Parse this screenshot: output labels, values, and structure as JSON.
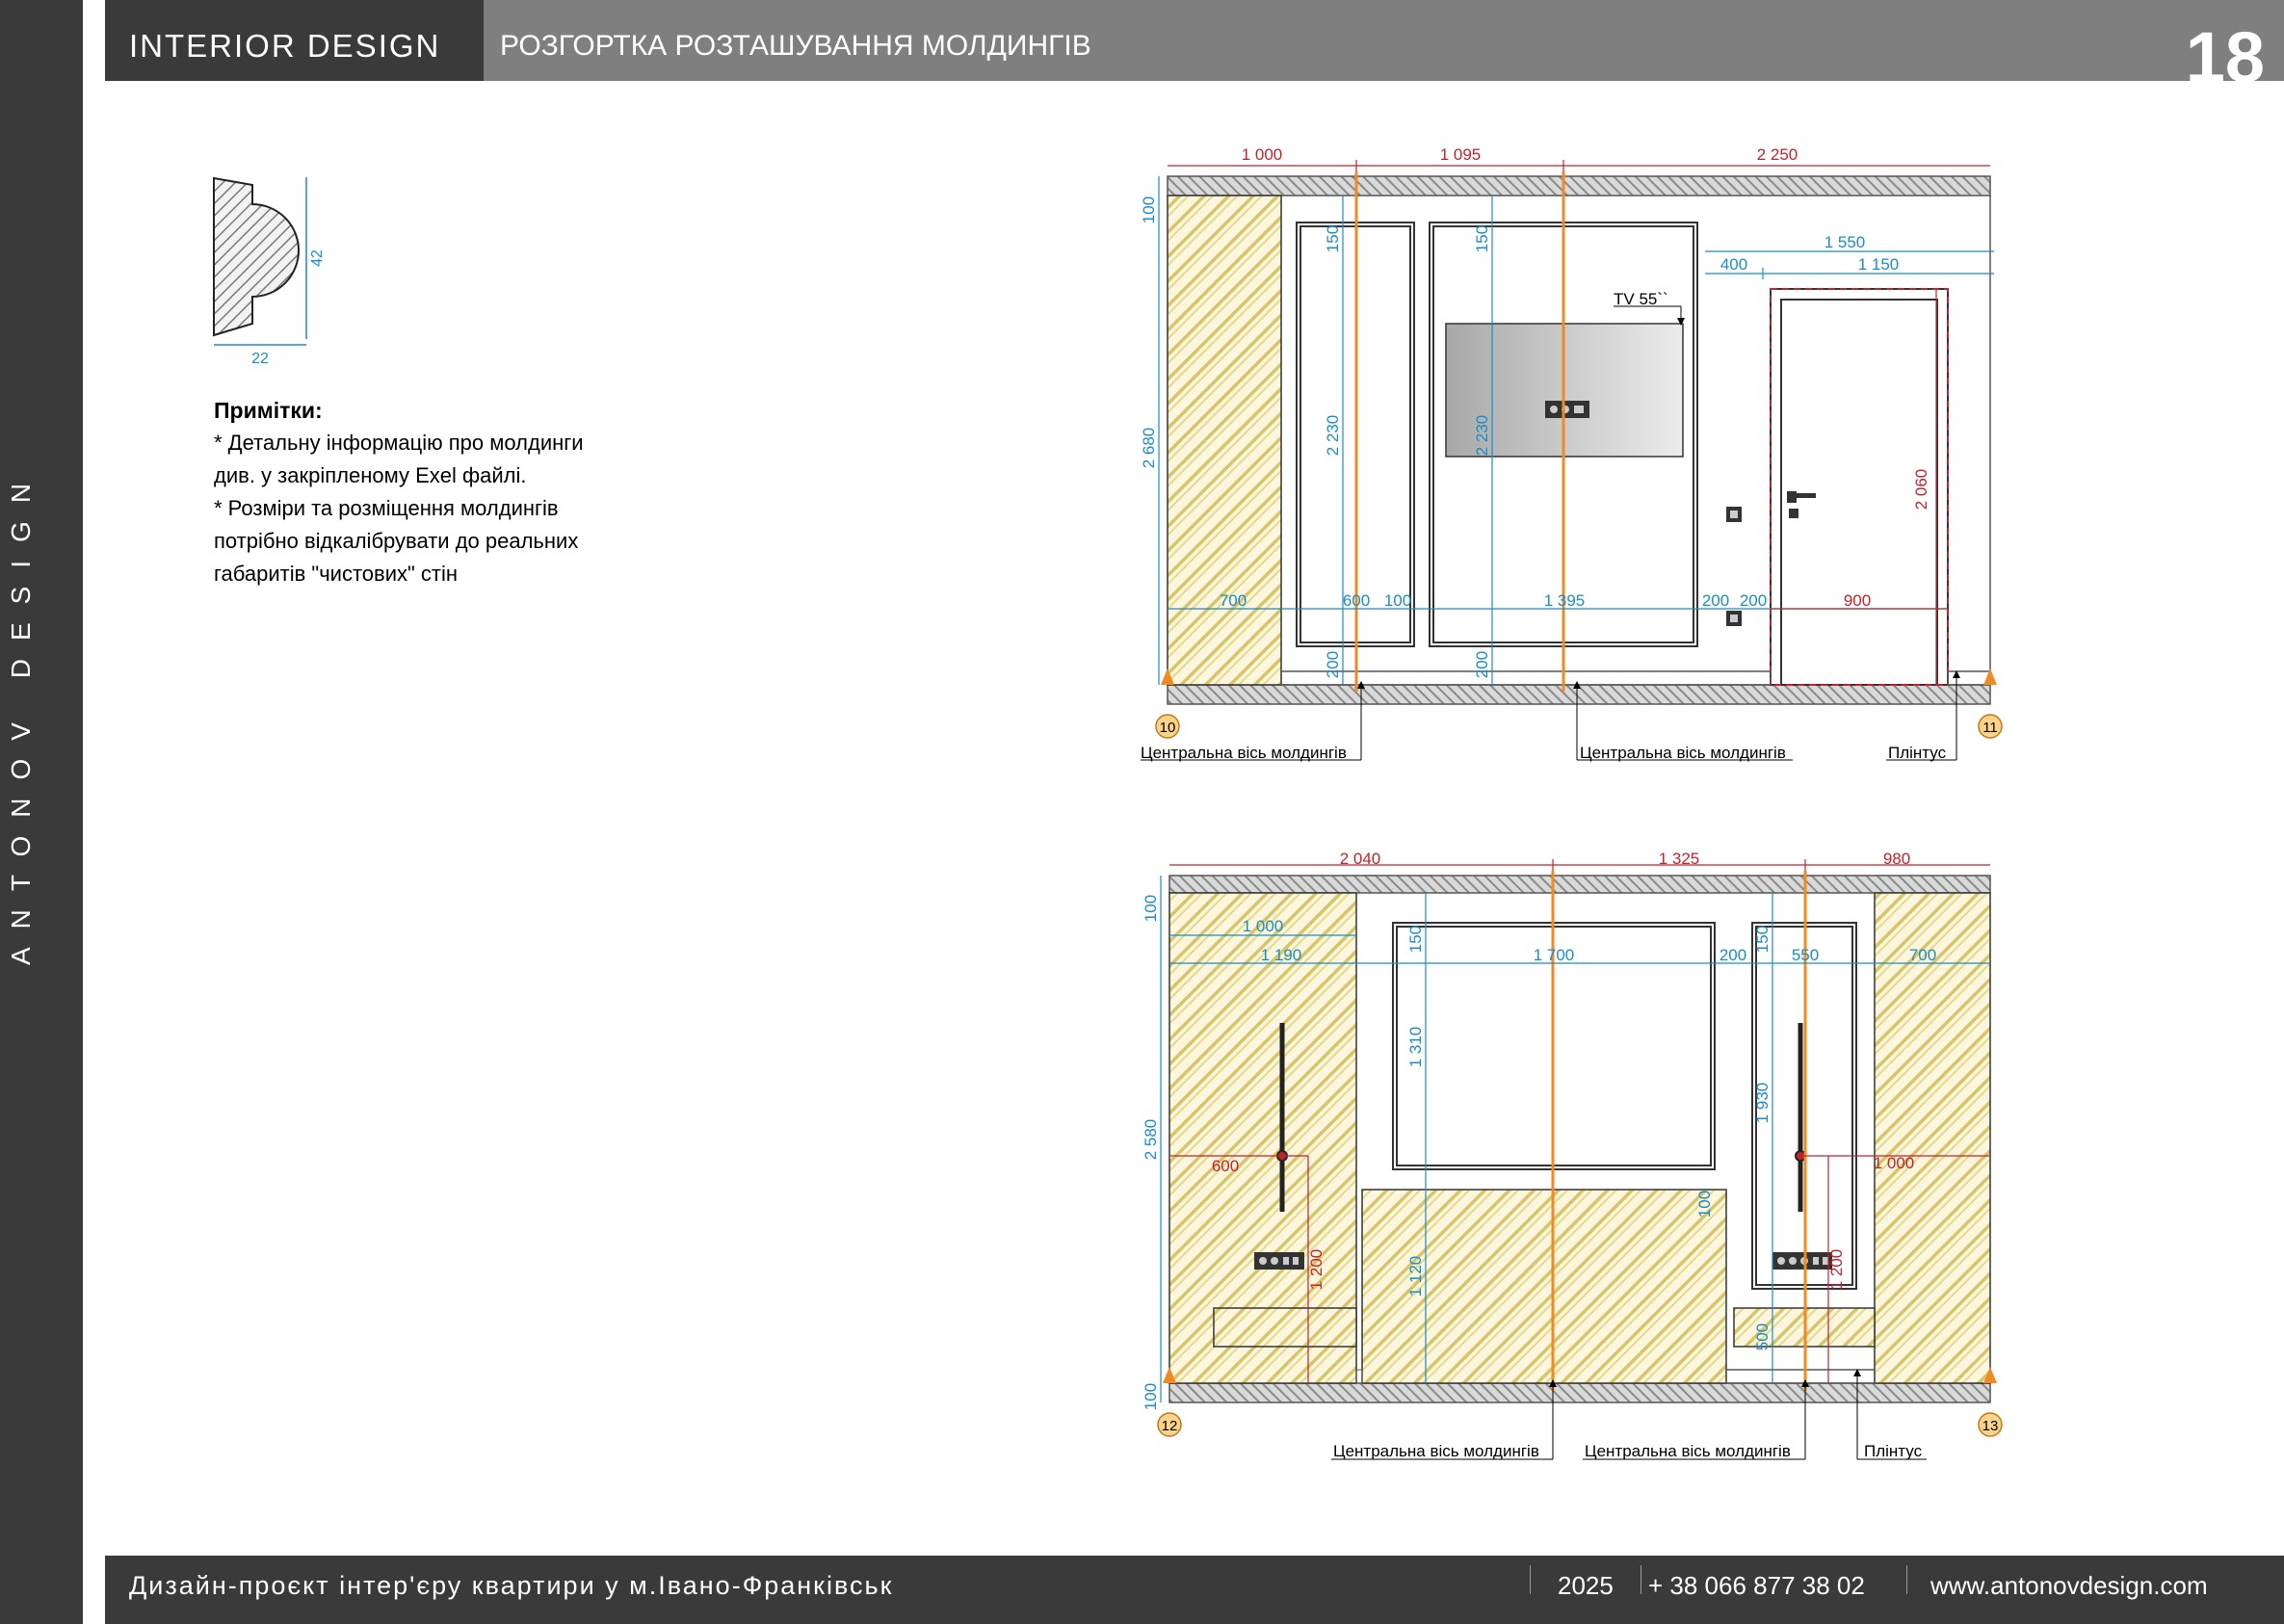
{
  "header": {
    "brand": "INTERIOR  DESIGN",
    "title": "РОЗГОРТКА РОЗТАШУВАННЯ МОЛДИНГІВ",
    "page_number": "18"
  },
  "sidebar": {
    "vertical_brand": "ANTONOV DESIGN"
  },
  "profile": {
    "width_label": "22",
    "height_label": "42"
  },
  "notes": {
    "title": "Примітки:",
    "lines": [
      "* Детальну інформацію про молдинги",
      "див. у закріпленому Exel файлі.",
      "* Розміри та розміщення молдингів",
      "потрібно відкалібрувати до реальних",
      "габаритів \"чистових\" стін"
    ]
  },
  "elevation1": {
    "top_dims": [
      "1 000",
      "1 095",
      "2 250"
    ],
    "left_dims": [
      "100",
      "2 680"
    ],
    "panel_dims": [
      "150",
      "2 230",
      "150",
      "2 230",
      "200",
      "200"
    ],
    "door_dims": [
      "1 550",
      "400",
      "1 150",
      "2 060"
    ],
    "bottom_dims": [
      "700",
      "600",
      "100",
      "1 395",
      "200",
      "200",
      "900"
    ],
    "tv_label": "TV 55``",
    "axis_left": "10",
    "axis_right": "11",
    "callouts": [
      "Центральна вісь молдингів",
      "Центральна вісь молдингів",
      "Плінтус"
    ]
  },
  "elevation2": {
    "top_dims": [
      "2 040",
      "1 325",
      "980"
    ],
    "left_dims": [
      "100",
      "2 580",
      "100"
    ],
    "row_dims": [
      "1 000",
      "1 190",
      "1 700",
      "200",
      "550",
      "700"
    ],
    "inner_dims": [
      "150",
      "1 310",
      "150",
      "1 930",
      "100",
      "1 120",
      "500"
    ],
    "red_dims": [
      "600",
      "1 200",
      "1 000",
      "1 200"
    ],
    "axis_left": "12",
    "axis_right": "13",
    "callouts": [
      "Центральна вісь молдингів",
      "Центральна вісь молдингів",
      "Плінтус"
    ]
  },
  "footer": {
    "project": "Дизайн-проєкт інтер'єру квартири у м.Івано-Франківськ",
    "year": "2025",
    "phone": "+ 38 066 877 38 02",
    "website": "www.antonovdesign.com"
  },
  "colors": {
    "dark": "#3a3a3a",
    "header_gray": "#7f7f7f",
    "dimension_blue": "#1a8cc8",
    "dimension_red": "#c0232b",
    "axis_orange": "#f08a24",
    "hatch_yellow": "#e6d98a"
  }
}
